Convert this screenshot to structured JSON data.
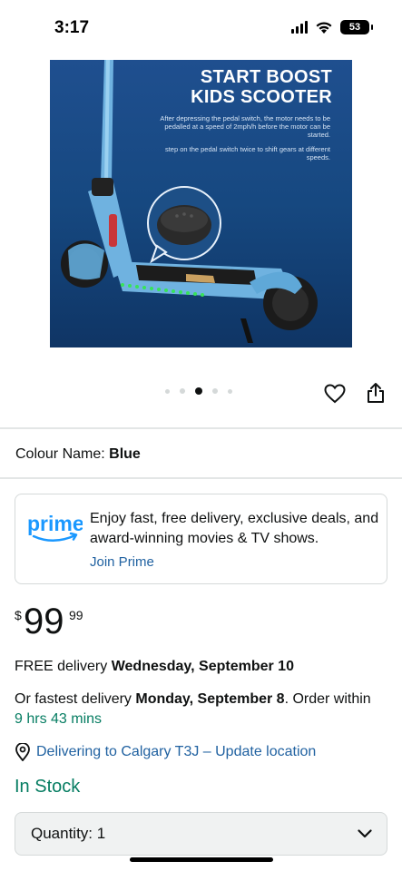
{
  "status_bar": {
    "time": "3:17",
    "battery": "53",
    "icons": [
      "signal-icon",
      "wifi-icon",
      "battery-icon"
    ]
  },
  "product_image": {
    "title_line1": "START BOOST",
    "title_line2": "KIDS SCOOTER",
    "caption1": "After depressing the pedal switch, the motor needs to be pedalled at a speed of 2mph/h before the motor can be started.",
    "caption2": "step on the pedal switch twice to shift gears at different speeds.",
    "carousel_total": 5,
    "carousel_active": 3
  },
  "actions": {
    "wishlist_icon": "heart-icon",
    "share_icon": "share-icon"
  },
  "colour": {
    "label": "Colour Name:",
    "value": "Blue"
  },
  "prime": {
    "logo_text": "prime",
    "description": "Enjoy fast, free delivery, exclusive deals, and award-winning movies & TV shows.",
    "join_label": "Join Prime"
  },
  "price": {
    "symbol": "$",
    "whole": "99",
    "fraction": "99"
  },
  "delivery": {
    "free_prefix": "FREE delivery ",
    "free_date": "Wednesday, September 10",
    "fast_prefix": "Or fastest delivery ",
    "fast_date": "Monday, September 8",
    "order_text": ". Order within ",
    "countdown": "9 hrs 43 mins"
  },
  "location": {
    "text": "Delivering to Calgary T3J – Update location",
    "icon": "location-pin-icon"
  },
  "stock": {
    "status": "In Stock"
  },
  "quantity": {
    "label": "Quantity: ",
    "value": "1",
    "icon": "chevron-down-icon"
  },
  "colors": {
    "link": "#2162a1",
    "stock_green": "#067d62",
    "text": "#0f1111",
    "prime_blue": "#1a98ff"
  }
}
